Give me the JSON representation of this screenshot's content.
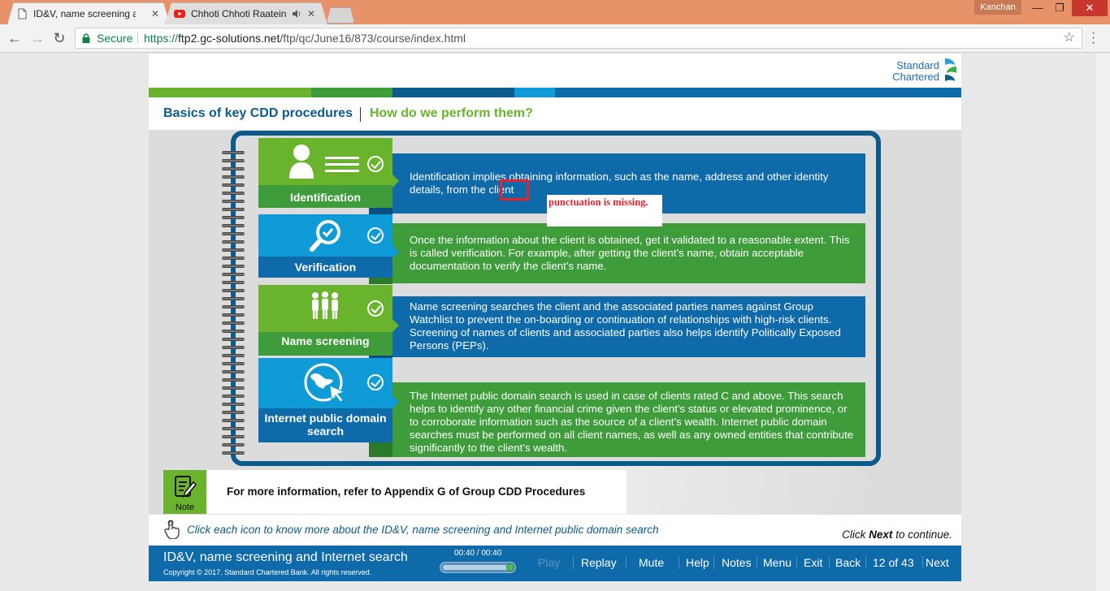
{
  "browser": {
    "tabs": [
      {
        "title": "ID&V, name screening ar",
        "close": "✕",
        "active": true
      },
      {
        "title": "Chhoti Chhoti Raatein",
        "close": "✕",
        "active": false
      }
    ],
    "user": "Kanchan",
    "window_controls": {
      "minimize": "—",
      "maximize": "❐",
      "close": "✕"
    },
    "toolbar": {
      "back": "←",
      "forward": "→",
      "reload": "↻",
      "secure_label": "Secure",
      "url_scheme": "https://",
      "url_host": "ftp2.gc-solutions.net",
      "url_path": "/ftp/qc/June16/873/course/index.html",
      "bookmark": "☆"
    }
  },
  "course": {
    "logo": {
      "line1": "Standard",
      "line2": "Chartered"
    },
    "strip_colors": [
      "#6ab42d",
      "#3e9c3a",
      "#0b5b8c",
      "#0f9bd7",
      "#0e6aa8"
    ],
    "title": "Basics of key CDD procedures",
    "subtitle": "How do we perform them?",
    "colors": {
      "green": "#6ab42d",
      "dark_green": "#3e9c3a",
      "blue": "#0e6aa8",
      "light_blue": "#0f9bd7",
      "navy": "#0b5b8c"
    },
    "items": [
      {
        "label": "Identification",
        "icon": "person-card-icon",
        "description": "Identification implies obtaining information, such as the name, address and other identity details, from the client"
      },
      {
        "label": "Verification",
        "icon": "magnifier-check-icon",
        "description": "Once the information about the client is obtained, get it validated to a reasonable extent. This is called verification. For example, after getting the client’s name, obtain acceptable documentation to verify the client’s name."
      },
      {
        "label": "Name screening",
        "icon": "people-group-icon",
        "description": "Name screening searches the client and the associated parties names against Group Watchlist to prevent the on-boarding or continuation of relationships with high-risk clients. Screening of names of clients and associated parties also helps identify Politically Exposed Persons (PEPs)."
      },
      {
        "label": "Internet public domain search",
        "icon": "globe-cursor-icon",
        "description": "The Internet public domain search is used in case of clients rated C and above. This search helps to identify any other financial crime given the client’s status or elevated prominence, or to corroborate information such as the source of a client’s wealth. Internet public domain searches must be performed on all client names, as well as any owned entities that contribute significantly to the client’s wealth."
      }
    ],
    "annotation": "punctuation is missing.",
    "note": {
      "label": "Note",
      "text": "For more information, refer to Appendix G of Group CDD Procedures"
    },
    "instruction": "Click each icon to know more about the ID&V, name screening and Internet public domain search",
    "continue": {
      "before": "Click ",
      "bold": "Next",
      "after": " to continue."
    },
    "footer": {
      "title": "ID&V, name screening and Internet search",
      "copyright": "Copyright © 2017. Standard Chartered Bank. All rights reserved.",
      "timer": "00:40 / 00:40",
      "progress": 1.0,
      "buttons": {
        "play": "Play",
        "replay": "Replay",
        "mute": "Mute",
        "help": "Help",
        "notes": "Notes",
        "menu": "Menu",
        "exit": "Exit",
        "back": "Back",
        "page": "12 of 43",
        "next": "Next"
      }
    }
  }
}
